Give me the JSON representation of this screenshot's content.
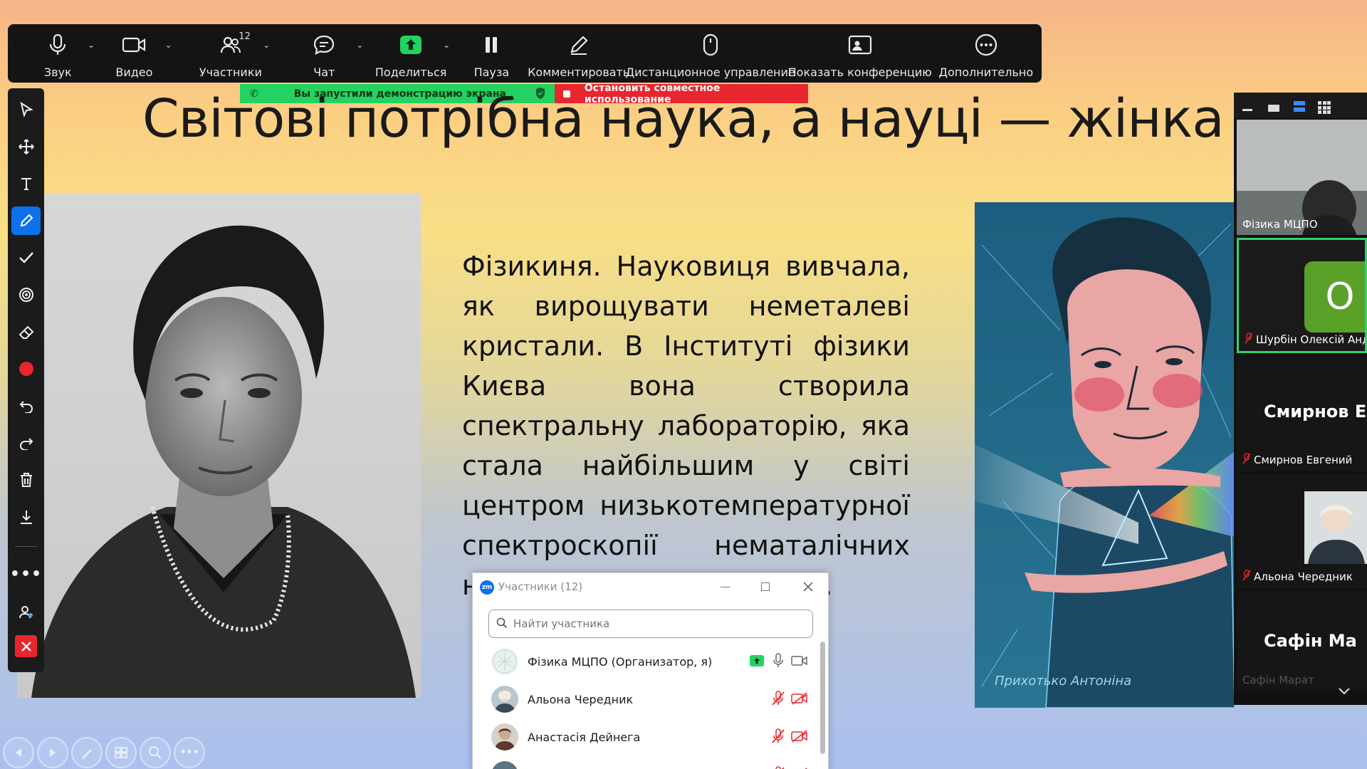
{
  "toolbar": {
    "audio": "Звук",
    "video": "Видео",
    "participants": "Участники",
    "participants_count": "12",
    "chat": "Чат",
    "share": "Поделиться",
    "pause": "Пауза",
    "annotate": "Комментировать",
    "remote_control": "Дистанционное управление",
    "show_meeting": "Показать конференцию",
    "more": "Дополнительно"
  },
  "share_banner": {
    "status": "Вы запустили демонстрацию экрана",
    "stop": "Остановить совместное использование"
  },
  "slide": {
    "title": "Світові потрібна наука, а науці — жінка",
    "body": "Фізикиня. Науковиця вивчала, як вирощувати неметалеві кристали. В Інституті фізики Києва вона створила спектральну лабораторію, яка стала найбільшим у світі центром низькотемпературної спектроскопії нематалічних н... ...ення в... ...виток ф...",
    "artist_signature": "Прихотько Антоніна"
  },
  "participants_window": {
    "logo": "zm",
    "title": "Участники (12)",
    "search_placeholder": "Найти участника",
    "rows": [
      {
        "name": "Фізика МЦПО (Организатор, я)"
      },
      {
        "name": "Альона Чередник"
      },
      {
        "name": "Анастасія Дейнега"
      }
    ]
  },
  "gallery": {
    "tiles": [
      {
        "name": "Фізика МЦПО"
      },
      {
        "initial": "О",
        "name": "Шурбін Олексій Андр"
      },
      {
        "big_name": "Смирнов Ев",
        "name": "Смирнов Евгений"
      },
      {
        "name": "Альона Чередник"
      },
      {
        "big_name": "Сафін Ма",
        "name": "Сафін Марат"
      }
    ]
  },
  "colors": {
    "toolbar_bg": "#141414",
    "share_green": "#23d260",
    "stop_red": "#e8262d",
    "active_speaker": "#2ed36f",
    "annot_active": "#0e71eb"
  }
}
